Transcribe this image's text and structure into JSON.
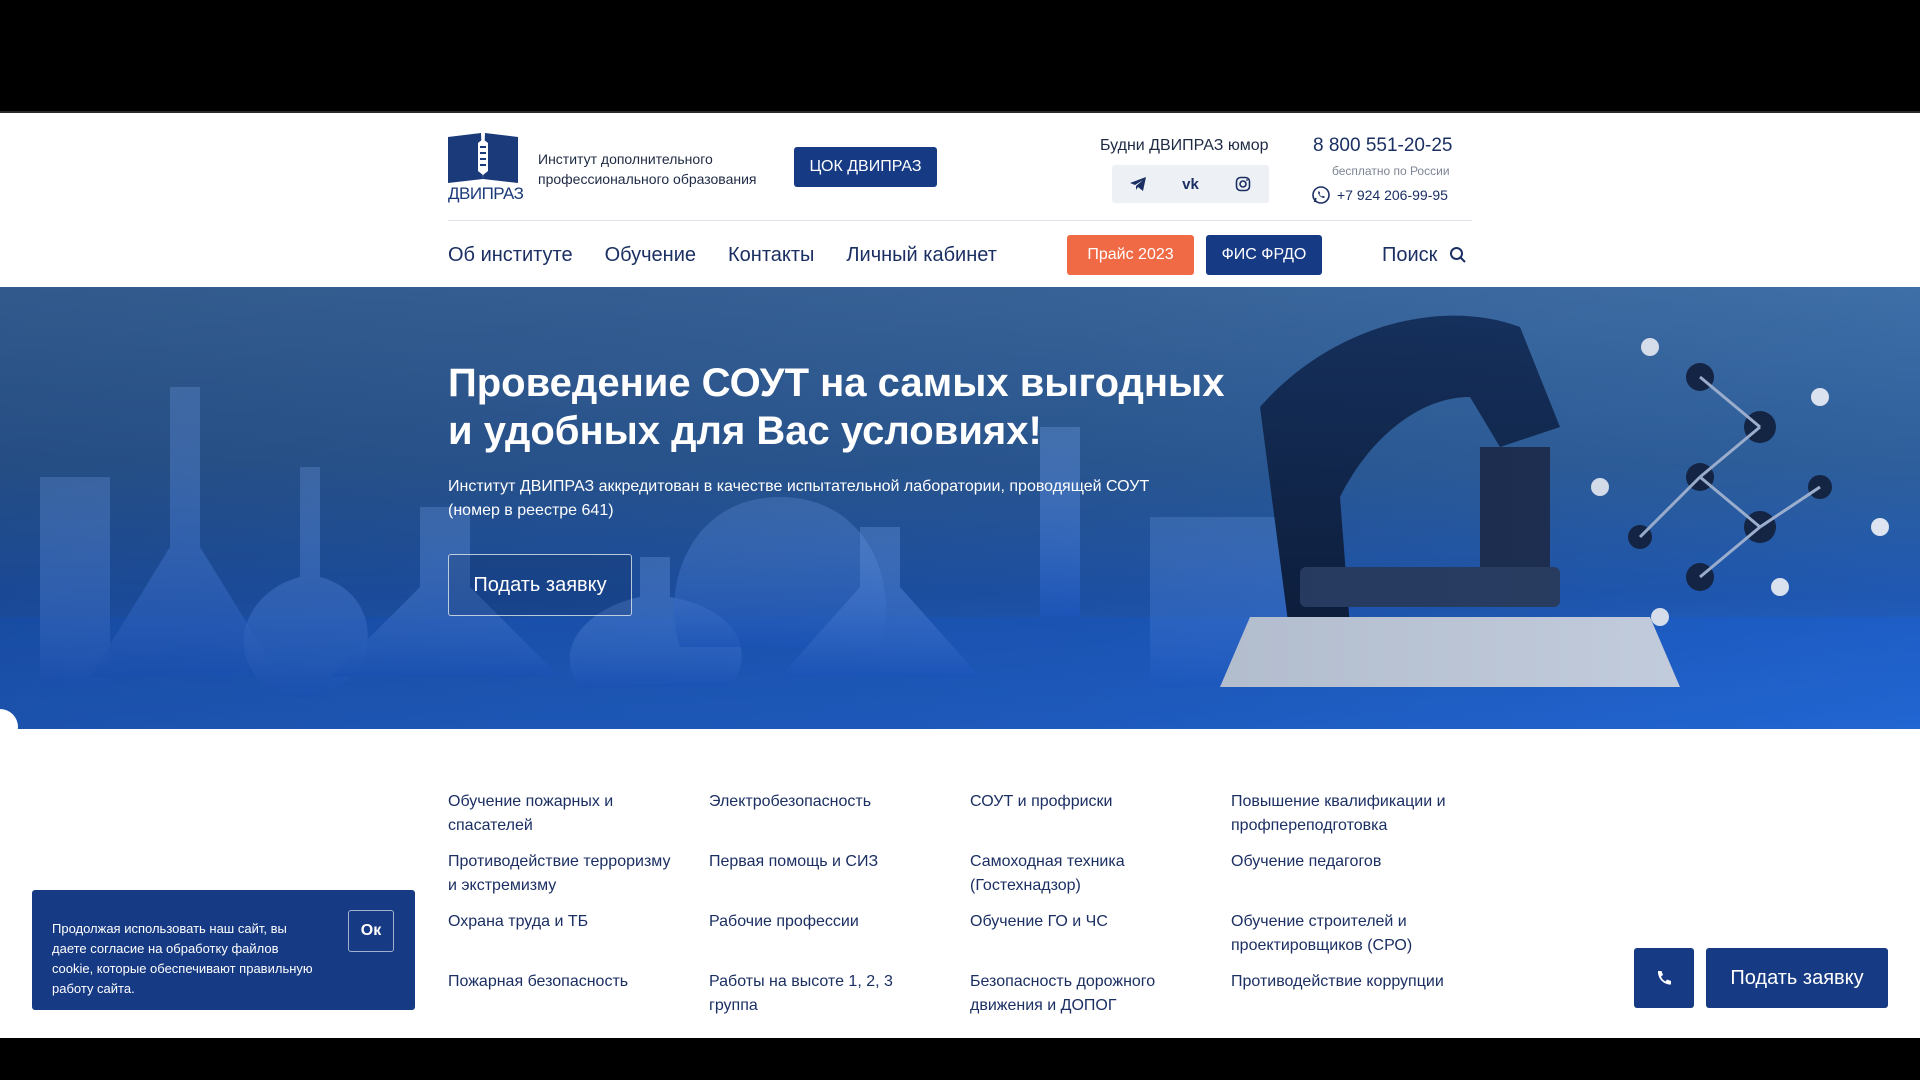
{
  "header": {
    "logo_text": "ДВИПРАЗ",
    "institute_name": "Институт дополнительного профессионального образования",
    "cok_button": "ЦОК ДВИПРАЗ",
    "humor_link": "Будни ДВИПРАЗ юмор",
    "social": [
      {
        "icon": "telegram-icon",
        "glyph": "➤"
      },
      {
        "icon": "vk-icon",
        "glyph": "vk"
      },
      {
        "icon": "instagram-icon",
        "glyph": "◎"
      }
    ],
    "phone_main": "8 800 551-20-25",
    "phone_note": "бесплатно по России",
    "phone_whatsapp": "+7 924 206-99-95"
  },
  "nav": {
    "items": [
      "Об институте",
      "Обучение",
      "Контакты",
      "Личный кабинет"
    ],
    "price_button": "Прайс 2023",
    "fis_button": "ФИС ФРДО",
    "search_label": "Поиск"
  },
  "hero": {
    "title": "Проведение СОУТ на самых выгодных и удобных для Вас условиях!",
    "subtitle": "Институт ДВИПРАЗ аккредитован в качестве испытательной лаборатории, проводящей СОУТ (номер в реестре 641)",
    "button": "Подать заявку"
  },
  "categories": [
    "Обучение пожарных и спасателей",
    "Электробезопасность",
    "СОУТ и профриски",
    "Повышение квалификации и профпереподготовка",
    "Противодействие терроризму и экстремизму",
    "Первая помощь и СИЗ",
    "Самоходная техника (Гостехнадзор)",
    "Обучение педагогов",
    "Охрана труда и ТБ",
    "Рабочие профессии",
    "Обучение ГО и ЧС",
    "Обучение строителей и проектировщиков (СРО)",
    "Пожарная безопасность",
    "Работы на высоте 1, 2, 3 группа",
    "Безопасность дорожного движения и ДОПОГ",
    "Противодействие коррупции"
  ],
  "cookie": {
    "text": "Продолжая использовать наш сайт, вы даете согласие на обработку файлов cookie, которые обеспечивают правильную работу сайта.",
    "ok": "Ок"
  },
  "floating": {
    "phone_icon": "phone-icon",
    "apply": "Подать заявку"
  },
  "colors": {
    "brand": "#163a84",
    "accent": "#f06a45",
    "text": "#1b2f63"
  }
}
